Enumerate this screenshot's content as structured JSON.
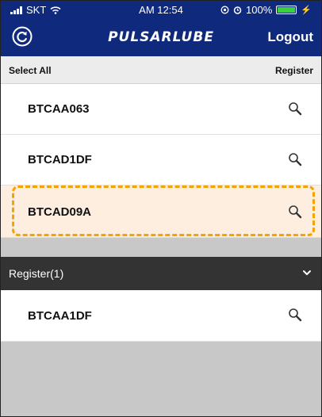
{
  "status_bar": {
    "carrier": "SKT",
    "time": "AM 12:54",
    "battery": "100%"
  },
  "header": {
    "logo_text": "PULSARLUBE",
    "logout_label": "Logout"
  },
  "actions": {
    "select_all_label": "Select All",
    "register_label": "Register"
  },
  "devices": [
    {
      "name": "BTCAA063"
    },
    {
      "name": "BTCAD1DF"
    },
    {
      "name": "BTCAD09A"
    }
  ],
  "registered_section": {
    "title": "Register(1)",
    "devices": [
      {
        "name": "BTCAA1DF"
      }
    ]
  },
  "colors": {
    "header_bg": "#0f2a7c",
    "highlight_border": "#f5a300",
    "highlight_bg": "#fdeee0",
    "section_bg": "#333333"
  }
}
